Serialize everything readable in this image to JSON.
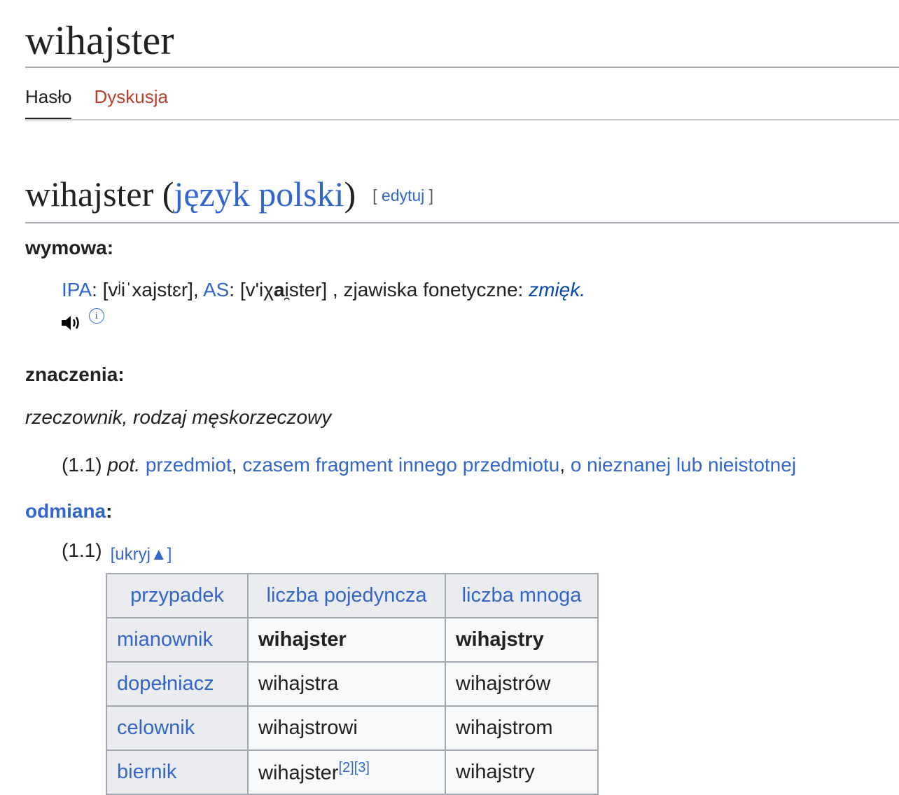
{
  "page": {
    "title": "wihajster",
    "tabs": [
      {
        "label": "Hasło",
        "active": true
      },
      {
        "label": "Dyskusja",
        "active": false
      }
    ]
  },
  "section": {
    "headword": "wihajster",
    "language": "język polski",
    "edit_label": "edytuj"
  },
  "pronunciation": {
    "label": "wymowa:",
    "ipa_link": "IPA",
    "ipa_value": "[vʲiˈxajstɛr]",
    "as_link": "AS",
    "as_value_prefix": "[vʹiχ",
    "as_value_bold": "a",
    "as_value_suffix": "i̯ster]",
    "phonetic_label": ", zjawiska fonetyczne: ",
    "phonetic_value": "zmięk.",
    "audio_icon": "speaker-icon",
    "info_icon": "info-icon",
    "info_glyph": "i"
  },
  "meanings": {
    "label": "znaczenia:",
    "part_of_speech": "rzeczownik, rodzaj męskorzeczowy",
    "definition": {
      "number": "(1.1)",
      "qualifier": "pot.",
      "links": [
        "przedmiot",
        "czasem fragment innego przedmiotu",
        "o nieznanej lub nieistotnej"
      ]
    }
  },
  "inflection": {
    "label": "odmiana",
    "number": "(1.1)",
    "toggle": "[ukryj",
    "toggle_icon": "triangle-up-icon",
    "toggle_glyph": "▲",
    "toggle_end": "]",
    "headers": [
      "przypadek",
      "liczba pojedyncza",
      "liczba mnoga"
    ],
    "rows": [
      {
        "case": "mianownik",
        "singular": "wihajster",
        "plural": "wihajstry",
        "refs": ""
      },
      {
        "case": "dopełniacz",
        "singular": "wihajstra",
        "plural": "wihajstrów",
        "refs": ""
      },
      {
        "case": "celownik",
        "singular": "wihajstrowi",
        "plural": "wihajstrom",
        "refs": ""
      },
      {
        "case": "biernik",
        "singular": "wihajster",
        "plural": "wihajstry",
        "refs": "[2][3]"
      }
    ]
  }
}
